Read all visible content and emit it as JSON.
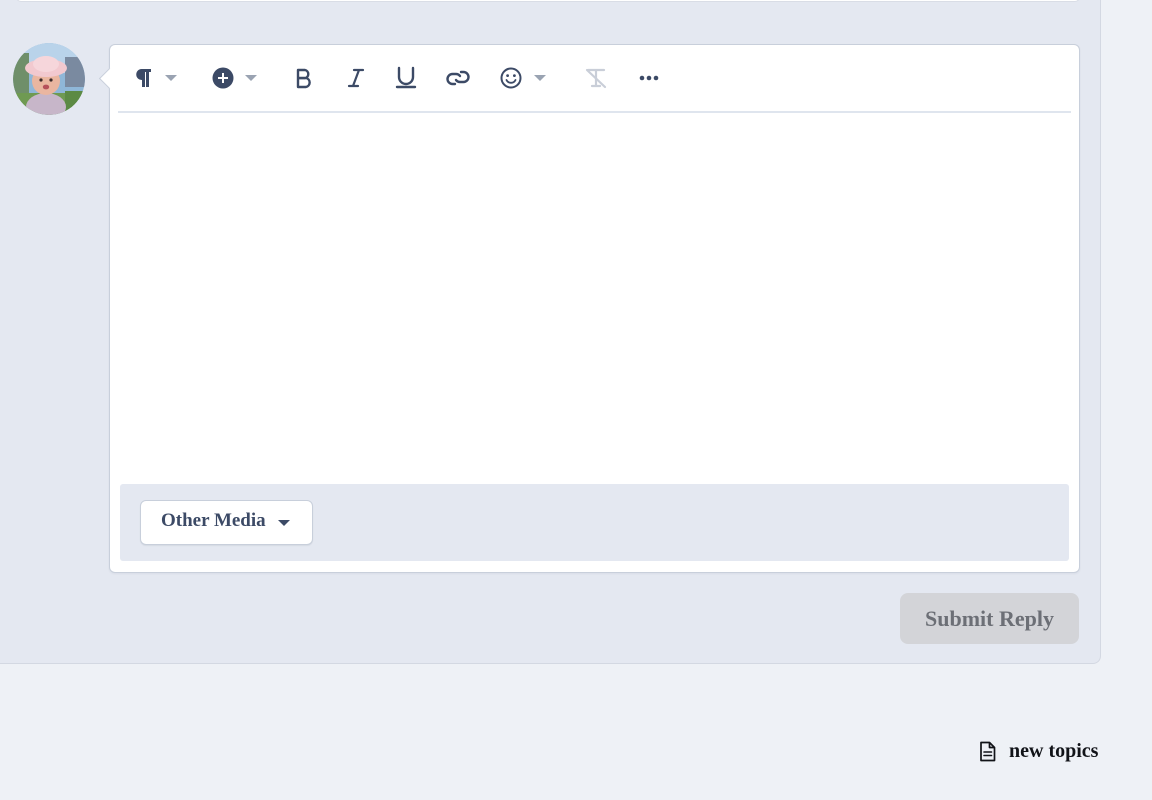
{
  "editor": {
    "content_text": ""
  },
  "toolbar": {
    "buttons": [
      {
        "name": "paragraph-format",
        "icon": "pilcrow-icon",
        "has_dropdown": true
      },
      {
        "name": "insert",
        "icon": "plus-circle-icon",
        "has_dropdown": true
      },
      {
        "name": "bold",
        "icon": "bold-icon",
        "has_dropdown": false
      },
      {
        "name": "italic",
        "icon": "italic-icon",
        "has_dropdown": false
      },
      {
        "name": "underline",
        "icon": "underline-icon",
        "has_dropdown": false
      },
      {
        "name": "link",
        "icon": "link-icon",
        "has_dropdown": false
      },
      {
        "name": "emoji",
        "icon": "smiley-icon",
        "has_dropdown": true
      },
      {
        "name": "clear-formatting",
        "icon": "clear-format-icon",
        "has_dropdown": false,
        "disabled": true
      },
      {
        "name": "more",
        "icon": "ellipsis-icon",
        "has_dropdown": false
      }
    ]
  },
  "media_bar": {
    "other_media_label": "Other Media"
  },
  "actions": {
    "submit_label": "Submit Reply"
  },
  "footer": {
    "new_topics_label": "new topics",
    "new_topics_icon": "document-icon"
  },
  "colors": {
    "icon": "#3c4a66",
    "icon_disabled": "#c9ced8",
    "panel_bg": "#e4e8f1",
    "page_bg": "#eef1f6",
    "submit_bg": "#d3d4d8",
    "submit_text": "#6c6f76"
  }
}
